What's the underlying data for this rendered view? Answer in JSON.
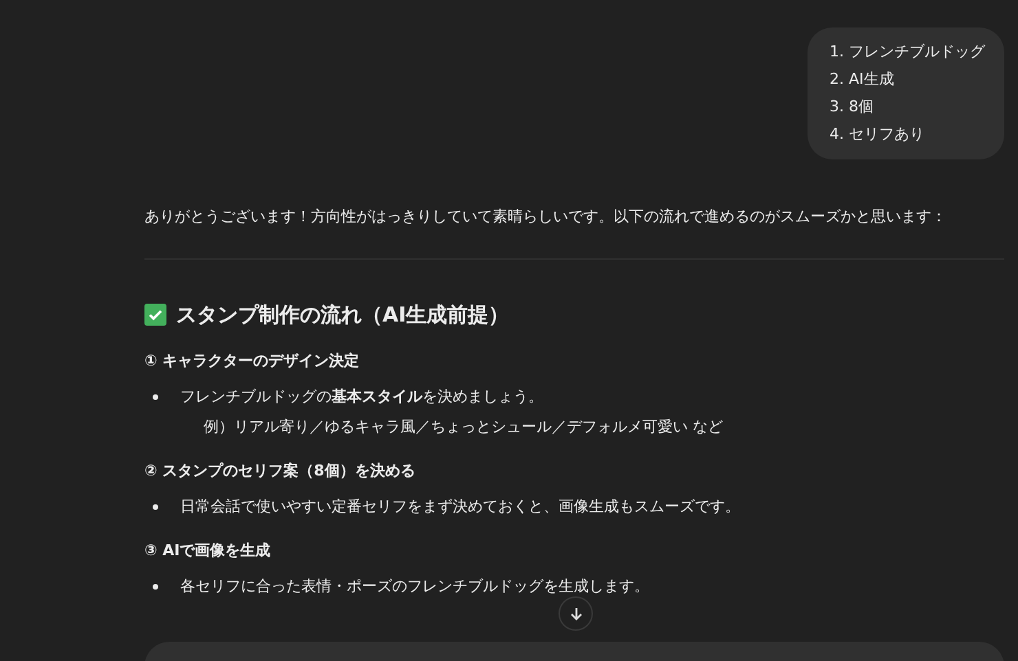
{
  "user_message": {
    "lines": [
      "1. フレンチブルドッグ",
      "2. AI生成",
      "3. 8個",
      "4. セリフあり"
    ]
  },
  "assistant": {
    "intro": "ありがとうございます！方向性がはっきりしていて素晴らしいです。以下の流れで進めるのがスムーズかと思います：",
    "heading": {
      "checked": true,
      "text": "スタンプ制作の流れ（AI生成前提）"
    },
    "steps": [
      {
        "title": "① キャラクターのデザイン決定",
        "bullets": [
          {
            "text": "フレンチブルドッグの**基本スタイル**を決めましょう。",
            "note": "例）リアル寄り／ゆるキャラ風／ちょっとシュール／デフォルメ可愛い など"
          }
        ]
      },
      {
        "title": "② スタンプのセリフ案（8個）を決める",
        "bullets": [
          {
            "text": "日常会話で使いやすい定番セリフをまず決めておくと、画像生成もスムーズです。"
          }
        ]
      },
      {
        "title": "③ AIで画像を生成",
        "bullets": [
          {
            "text": "各セリフに合った表情・ポーズのフレンチブルドッグを生成します。"
          }
        ]
      }
    ]
  }
}
